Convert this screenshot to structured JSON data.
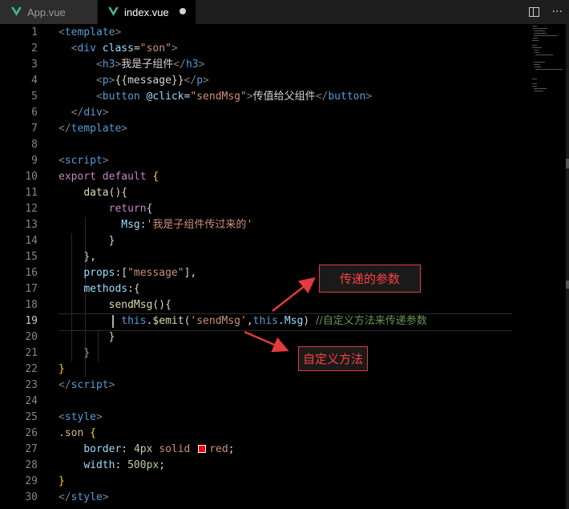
{
  "tabs": [
    {
      "label": "App.vue",
      "active": false
    },
    {
      "label": "index.vue",
      "active": true,
      "unsaved": true
    }
  ],
  "editor": {
    "active_line": 19,
    "lines": [
      {
        "n": "1"
      },
      {
        "n": "2"
      },
      {
        "n": "3"
      },
      {
        "n": "4"
      },
      {
        "n": "5"
      },
      {
        "n": "6"
      },
      {
        "n": "7"
      },
      {
        "n": "8"
      },
      {
        "n": "9"
      },
      {
        "n": "10"
      },
      {
        "n": "11"
      },
      {
        "n": "12"
      },
      {
        "n": "13"
      },
      {
        "n": "14"
      },
      {
        "n": "15"
      },
      {
        "n": "16"
      },
      {
        "n": "17"
      },
      {
        "n": "18"
      },
      {
        "n": "19"
      },
      {
        "n": "20"
      },
      {
        "n": "21"
      },
      {
        "n": "22"
      },
      {
        "n": "23"
      },
      {
        "n": "24"
      },
      {
        "n": "25"
      },
      {
        "n": "26"
      },
      {
        "n": "27"
      },
      {
        "n": "28"
      },
      {
        "n": "29"
      },
      {
        "n": "30"
      }
    ],
    "code": {
      "l1": [
        "<",
        "template",
        ">"
      ],
      "l2": [
        "<",
        "div",
        " ",
        "class",
        "=",
        "\"son\"",
        ">"
      ],
      "l3": [
        "<",
        "h3",
        ">",
        "我是子组件",
        "</",
        "h3",
        ">"
      ],
      "l4": [
        "<",
        "p",
        ">",
        "{{message}}",
        "</",
        "p",
        ">"
      ],
      "l5": [
        "<",
        "button",
        " ",
        "@click",
        "=",
        "\"sendMsg\"",
        ">",
        "传值给父组件",
        "</",
        "button",
        ">"
      ],
      "l6": [
        "</",
        "div",
        ">"
      ],
      "l7": [
        "</",
        "template",
        ">"
      ],
      "l9": [
        "<",
        "script",
        ">"
      ],
      "l10": [
        "export",
        " ",
        "default",
        " ",
        "{"
      ],
      "l11": [
        "data",
        "(){"
      ],
      "l12": [
        "return",
        "{"
      ],
      "l13": [
        "Msg",
        ":",
        "'",
        "我是子组件传过来的",
        "'"
      ],
      "l14": [
        "}"
      ],
      "l15": [
        "},"
      ],
      "l16": [
        "props",
        ":[",
        "\"message\"",
        "],"
      ],
      "l17": [
        "methods",
        ":{"
      ],
      "l18": [
        "sendMsg",
        "(){"
      ],
      "l19": [
        "this",
        ".",
        "$emit",
        "(",
        "'sendMsg'",
        ",",
        "this",
        ".",
        "Msg",
        ")",
        " ",
        "//自定义方法来传递参数"
      ],
      "l20": [
        "}"
      ],
      "l21": [
        "}"
      ],
      "l22": [
        "}"
      ],
      "l23": [
        "</",
        "script",
        ">"
      ],
      "l25": [
        "<",
        "style",
        ">"
      ],
      "l26": [
        ".son",
        " ",
        "{"
      ],
      "l27": [
        "border",
        ":",
        " ",
        "4px",
        " ",
        "solid",
        " ",
        "red",
        ";"
      ],
      "l28": [
        "width",
        ":",
        " ",
        "500px",
        ";"
      ],
      "l29": [
        "}"
      ],
      "l30": [
        "</",
        "style",
        ">"
      ]
    }
  },
  "annotations": {
    "params_label": "传递的参数",
    "method_label": "自定义方法"
  },
  "colors": {
    "callout_border": "#e23b3b",
    "callout_text": "#ff4040",
    "swatch": "#ff0000"
  },
  "icons": [
    "vue-icon",
    "split-editor-icon",
    "more-actions-icon"
  ]
}
